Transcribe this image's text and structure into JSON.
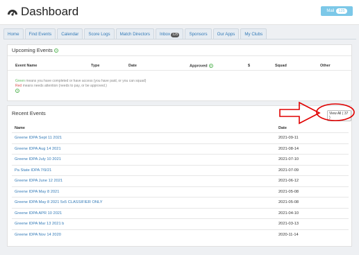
{
  "header": {
    "title": "Dashboard",
    "mail_label": "Mail",
    "mail_count": "125"
  },
  "nav": {
    "tabs": [
      {
        "label": "Home",
        "badge": ""
      },
      {
        "label": "Find Events",
        "badge": ""
      },
      {
        "label": "Calendar",
        "badge": ""
      },
      {
        "label": "Score Logs",
        "badge": ""
      },
      {
        "label": "Match Directors",
        "badge": ""
      },
      {
        "label": "Inbox",
        "badge": "125"
      },
      {
        "label": "Sponsors",
        "badge": ""
      },
      {
        "label": "Our Apps",
        "badge": ""
      },
      {
        "label": "My Clubs",
        "badge": ""
      }
    ]
  },
  "upcoming": {
    "title": "Upcoming Events",
    "columns": [
      "Event Name",
      "Type",
      "Date",
      "Approved",
      "$",
      "Squad",
      "Other"
    ],
    "legend_green_word": "Green",
    "legend_green_rest": " means you have completed or have access (you have paid, or you can squad)",
    "legend_red_word": "Red",
    "legend_red_rest": " means needs attention (needs to pay, or be approved.)"
  },
  "recent": {
    "title": "Recent Events",
    "view_all": "View All ( 37 )",
    "columns": [
      "Name",
      "Date"
    ],
    "rows": [
      {
        "name": "Greene IDPA Sept 11 2021",
        "date": "2021-09-11"
      },
      {
        "name": "Greene IDPA Aug 14 2021",
        "date": "2021-08-14"
      },
      {
        "name": "Greene IDPA July 10 2021",
        "date": "2021-07-10"
      },
      {
        "name": "Pa State IDPA 7/9/21",
        "date": "2021-07-09"
      },
      {
        "name": "Greene IDPA June 12 2021",
        "date": "2021-06-12"
      },
      {
        "name": "Greene IDPA May 8 2021",
        "date": "2021-05-08"
      },
      {
        "name": "Greene IDPA May 8 2021 5x5 CLASSIFIER ONLY",
        "date": "2021-05-08"
      },
      {
        "name": "Greene IDPA APR 10 2021",
        "date": "2021-04-10"
      },
      {
        "name": "Greene IDPA Mar 13 2021 b",
        "date": "2021-03-13"
      },
      {
        "name": "Greene IDPA Nov 14 2020",
        "date": "2020-11-14"
      }
    ]
  },
  "colors": {
    "link": "#337ab7",
    "mail_button": "#7cc8e8",
    "green": "#5cb85c",
    "red": "#d9534f",
    "annotation": "#e00000"
  },
  "icons": [
    "dashboard-gauge-icon",
    "help-circle-icon",
    "annotation-arrow",
    "annotation-circle"
  ]
}
